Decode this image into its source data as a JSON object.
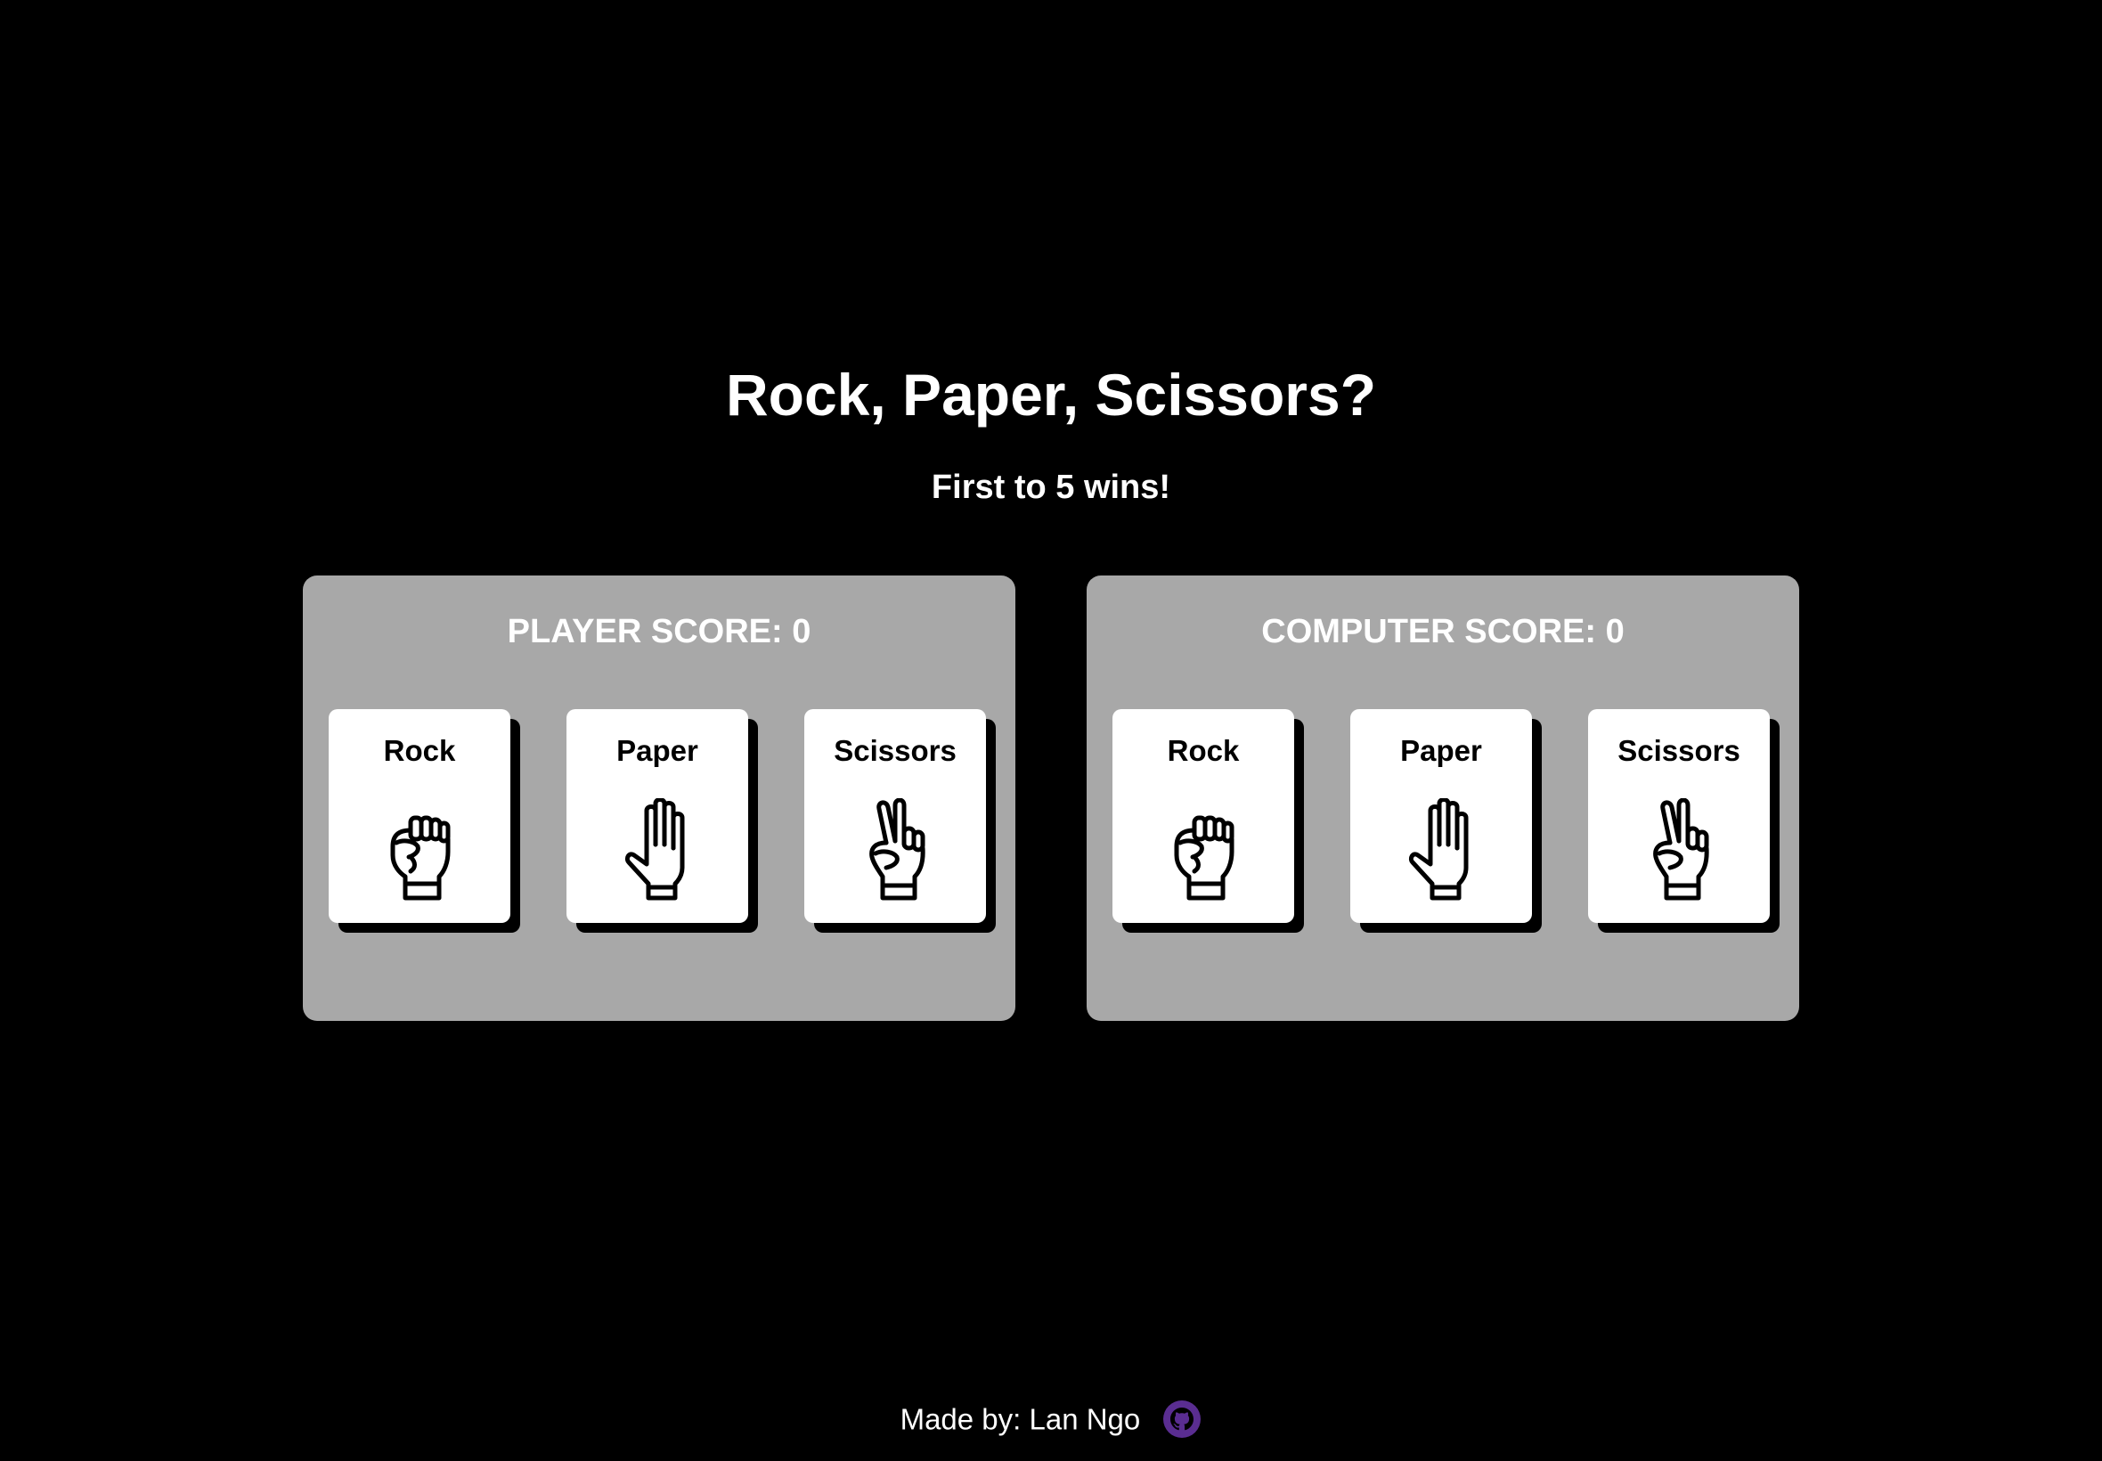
{
  "header": {
    "title": "Rock, Paper, Scissors?",
    "subtitle": "First to 5 wins!"
  },
  "player": {
    "score_label": "PLAYER SCORE: 0",
    "choices": [
      {
        "label": "Rock",
        "icon": "rock-hand-icon"
      },
      {
        "label": "Paper",
        "icon": "paper-hand-icon"
      },
      {
        "label": "Scissors",
        "icon": "scissors-hand-icon"
      }
    ]
  },
  "computer": {
    "score_label": "COMPUTER SCORE: 0",
    "choices": [
      {
        "label": "Rock",
        "icon": "rock-hand-icon"
      },
      {
        "label": "Paper",
        "icon": "paper-hand-icon"
      },
      {
        "label": "Scissors",
        "icon": "scissors-hand-icon"
      }
    ]
  },
  "footer": {
    "credit": "Made by: Lan Ngo",
    "link_icon": "github-icon"
  },
  "colors": {
    "background": "#000000",
    "panel": "#a8a8a8",
    "card": "#ffffff",
    "text": "#ffffff",
    "github_accent": "#5a2d91"
  }
}
